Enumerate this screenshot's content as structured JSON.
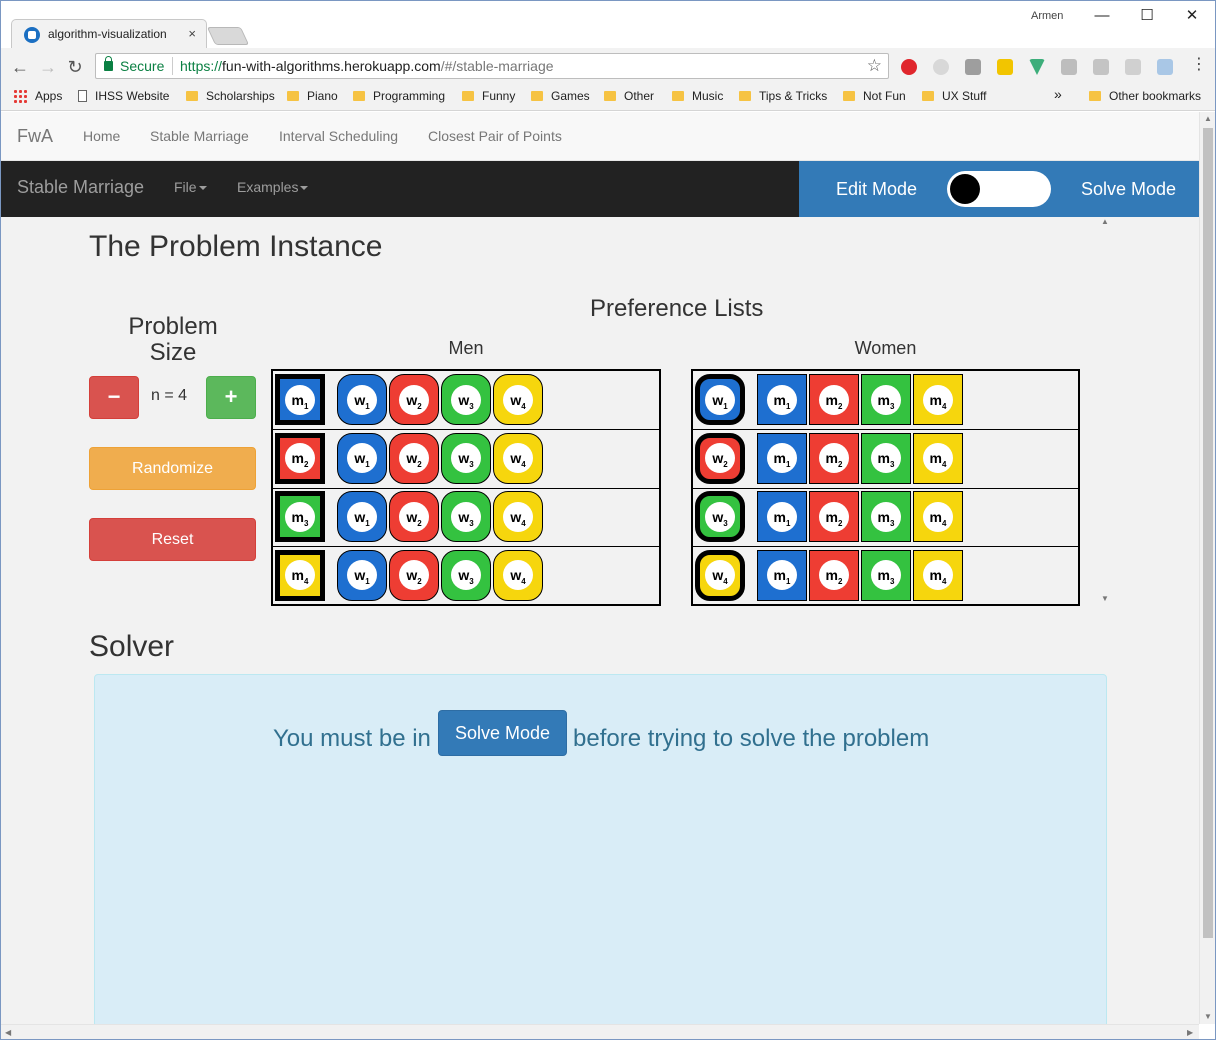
{
  "browser": {
    "tab_title": "algorithm-visualization",
    "tab_close": "×",
    "user": "Armen",
    "window_buttons": [
      "—",
      "☐",
      "✕"
    ],
    "back": "←",
    "forward": "→",
    "reload": "↻",
    "secure_label": "Secure",
    "url_proto": "https://",
    "url_host": "fun-with-algorithms.herokuapp.com",
    "url_path": "/#/stable-marriage",
    "star": "☆",
    "menu": "⋮"
  },
  "bookmarks": {
    "apps": "Apps",
    "items": [
      "IHSS Website",
      "Scholarships",
      "Piano",
      "Programming",
      "Funny",
      "Games",
      "Other",
      "Music",
      "Tips & Tricks",
      "Not Fun",
      "UX Stuff"
    ],
    "overflow": "»",
    "other": "Other bookmarks"
  },
  "site_nav": {
    "brand": "FwA",
    "links": [
      "Home",
      "Stable Marriage",
      "Interval Scheduling",
      "Closest Pair of Points"
    ]
  },
  "subnav": {
    "title": "Stable Marriage",
    "file": "File",
    "examples": "Examples",
    "edit_mode": "Edit Mode",
    "solve_mode": "Solve Mode",
    "toggle_state": "edit"
  },
  "problem": {
    "title": "The Problem Instance",
    "size_title": "Problem Size",
    "minus": "−",
    "plus": "+",
    "n_label": "n = 4",
    "randomize": "Randomize",
    "reset": "Reset",
    "pref_title": "Preference Lists",
    "men_title": "Men",
    "women_title": "Women"
  },
  "colors": {
    "blue": "#1e6fd0",
    "red": "#ee3d33",
    "green": "#34c240",
    "yellow": "#f6d60d"
  },
  "men": [
    {
      "letter": "m",
      "index": "1",
      "prefs": [
        "1",
        "2",
        "3",
        "4"
      ]
    },
    {
      "letter": "m",
      "index": "2",
      "prefs": [
        "1",
        "2",
        "3",
        "4"
      ]
    },
    {
      "letter": "m",
      "index": "3",
      "prefs": [
        "1",
        "2",
        "3",
        "4"
      ]
    },
    {
      "letter": "m",
      "index": "4",
      "prefs": [
        "1",
        "2",
        "3",
        "4"
      ]
    }
  ],
  "women": [
    {
      "letter": "w",
      "index": "1",
      "prefs": [
        "1",
        "2",
        "3",
        "4"
      ]
    },
    {
      "letter": "w",
      "index": "2",
      "prefs": [
        "1",
        "2",
        "3",
        "4"
      ]
    },
    {
      "letter": "w",
      "index": "3",
      "prefs": [
        "1",
        "2",
        "3",
        "4"
      ]
    },
    {
      "letter": "w",
      "index": "4",
      "prefs": [
        "1",
        "2",
        "3",
        "4"
      ]
    }
  ],
  "solver": {
    "title": "Solver",
    "msg_before": "You must be in",
    "button": "Solve Mode",
    "msg_after": "before trying to solve the problem"
  }
}
